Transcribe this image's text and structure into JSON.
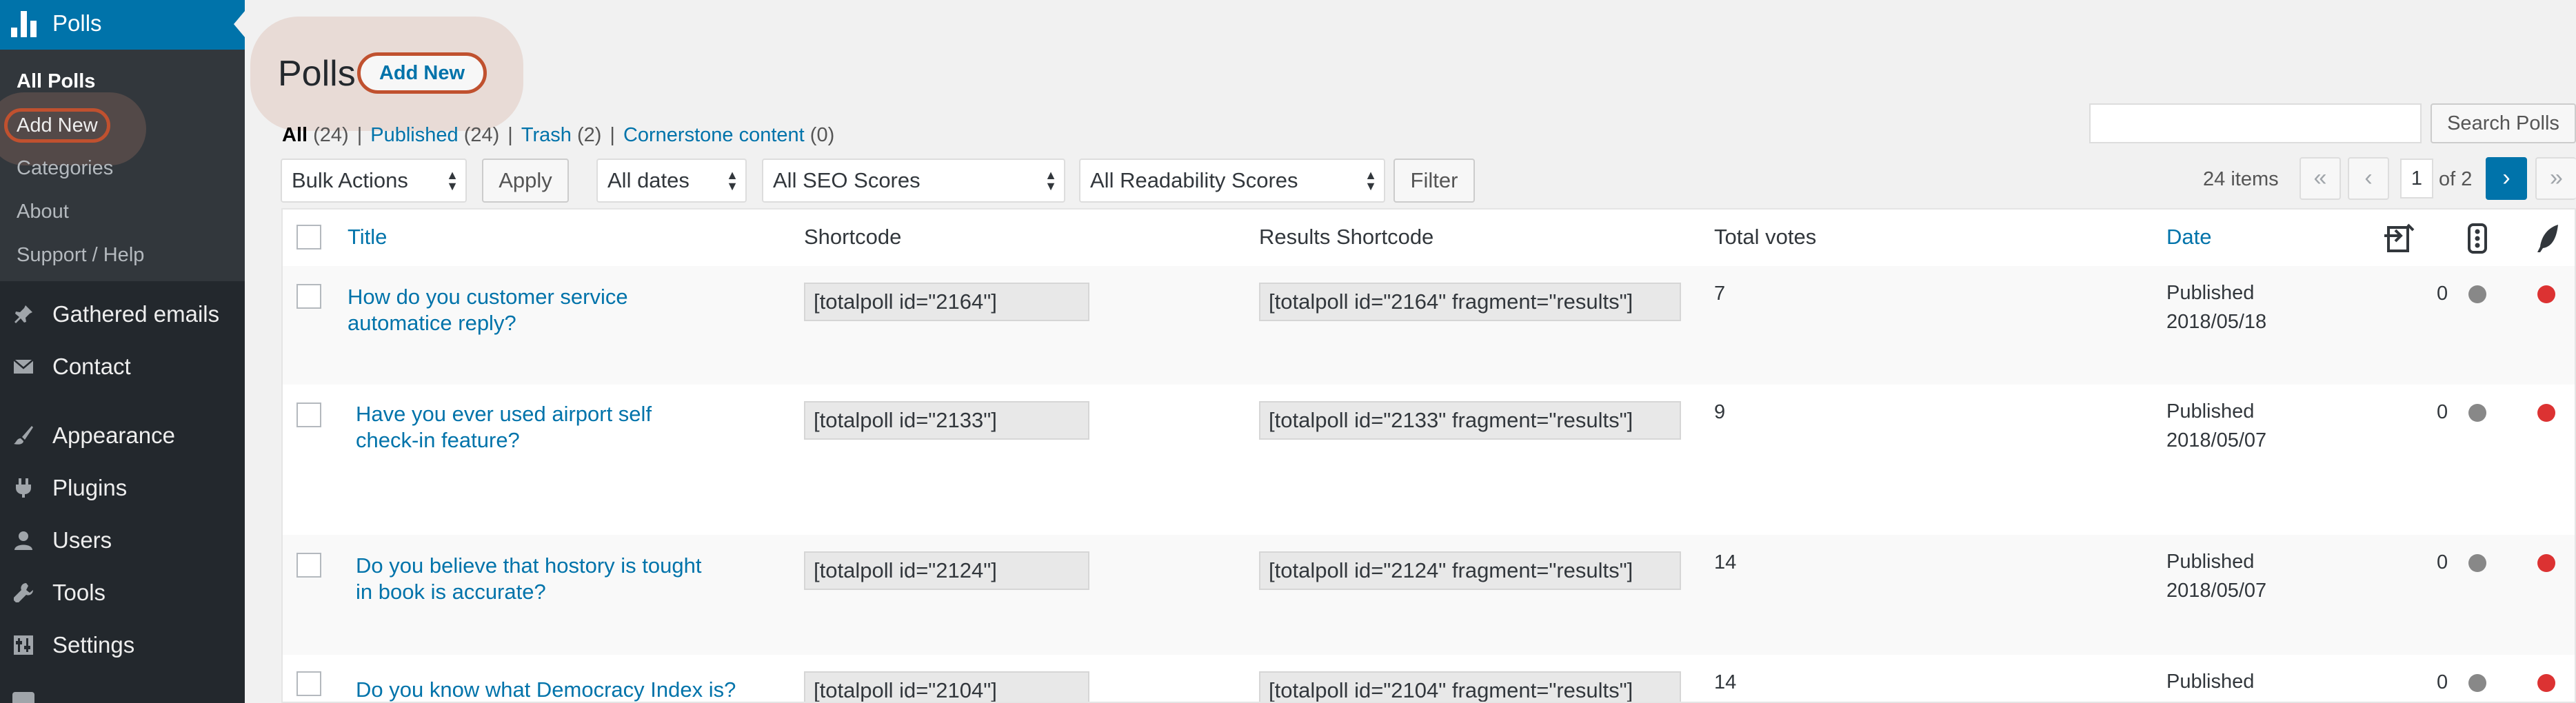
{
  "sidebar": {
    "top": {
      "label": "Polls",
      "icon": "chart-bar-icon",
      "color": "#0073aa"
    },
    "submenu": [
      {
        "label": "All Polls",
        "current": true
      },
      {
        "label": "Add New",
        "highlighted": true
      },
      {
        "label": "Categories"
      },
      {
        "label": "About"
      },
      {
        "label": "Support / Help"
      }
    ],
    "items": [
      {
        "label": "Gathered emails",
        "icon": "pushpin-icon"
      },
      {
        "label": "Contact",
        "icon": "envelope-icon"
      },
      {
        "label": "Appearance",
        "icon": "paintbrush-icon"
      },
      {
        "label": "Plugins",
        "icon": "plug-icon"
      },
      {
        "label": "Users",
        "icon": "user-icon"
      },
      {
        "label": "Tools",
        "icon": "wrench-icon"
      },
      {
        "label": "Settings",
        "icon": "settings-sliders-icon"
      }
    ]
  },
  "header": {
    "title": "Polls",
    "add_new": "Add New"
  },
  "views": {
    "all": {
      "label": "All",
      "count": "(24)"
    },
    "published": {
      "label": "Published",
      "count": "(24)"
    },
    "trash": {
      "label": "Trash",
      "count": "(2)"
    },
    "cornerstone": {
      "label": "Cornerstone content",
      "count": "(0)"
    }
  },
  "search": {
    "button": "Search Polls",
    "value": ""
  },
  "filters": {
    "bulk": "Bulk Actions",
    "apply": "Apply",
    "dates": "All dates",
    "seo": "All SEO Scores",
    "readability": "All Readability Scores",
    "filter": "Filter"
  },
  "pagination": {
    "items": "24 items",
    "first": "«",
    "prev": "‹",
    "current": "1",
    "of": "of 2",
    "next": "›",
    "last": "»"
  },
  "table": {
    "columns": {
      "title": "Title",
      "shortcode": "Shortcode",
      "results": "Results Shortcode",
      "votes": "Total votes",
      "date": "Date"
    },
    "column_icons": [
      "internal-links-icon",
      "seo-traffic-light-icon",
      "readability-feather-icon"
    ],
    "rows": [
      {
        "title_l1": "How do you customer service",
        "title_l2": "automatice reply?",
        "shortcode": "[totalpoll id=\"2164\"]",
        "results": "[totalpoll id=\"2164\" fragment=\"results\"]",
        "votes": "7",
        "status": "Published",
        "date": "2018/05/18",
        "links": "0",
        "seo": "#888888",
        "readability": "#dc3232"
      },
      {
        "title_l1": "Have you ever used airport self",
        "title_l2": "check-in feature?",
        "shortcode": "[totalpoll id=\"2133\"]",
        "results": "[totalpoll id=\"2133\" fragment=\"results\"]",
        "votes": "9",
        "status": "Published",
        "date": "2018/05/07",
        "links": "0",
        "seo": "#888888",
        "readability": "#dc3232"
      },
      {
        "title_l1": "Do you believe that hostory is tought",
        "title_l2": "in book is accurate?",
        "shortcode": "[totalpoll id=\"2124\"]",
        "results": "[totalpoll id=\"2124\" fragment=\"results\"]",
        "votes": "14",
        "status": "Published",
        "date": "2018/05/07",
        "links": "0",
        "seo": "#888888",
        "readability": "#dc3232"
      },
      {
        "title_l1": "Do you know what Democracy Index is?",
        "title_l2": "",
        "shortcode": "[totalpoll id=\"2104\"]",
        "results": "[totalpoll id=\"2104\" fragment=\"results\"]",
        "votes": "14",
        "status": "Published",
        "date": "",
        "links": "0",
        "seo": "#888888",
        "readability": "#dc3232"
      }
    ]
  }
}
